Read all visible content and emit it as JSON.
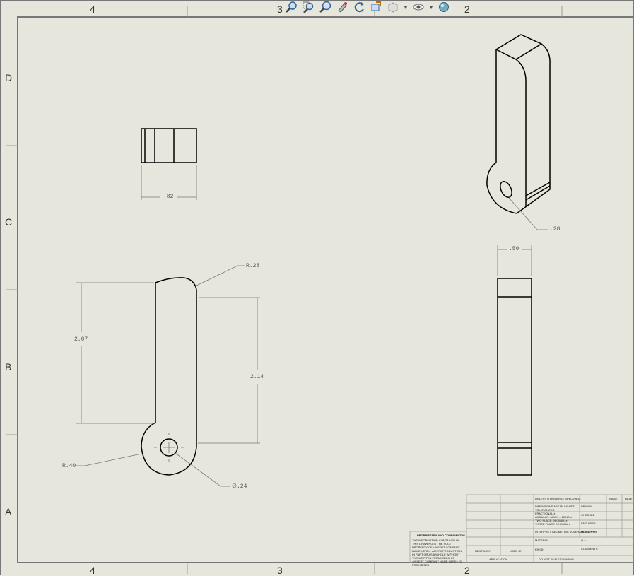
{
  "zones": {
    "top": [
      "4",
      "3",
      "2"
    ],
    "bottom": [
      "4",
      "3",
      "2"
    ],
    "left": [
      "D",
      "C",
      "B",
      "A"
    ]
  },
  "toolbar": {
    "icons": [
      "zoom-to-fit-icon",
      "zoom-to-area-icon",
      "zoom-in-out-icon",
      "pan-icon",
      "rotate-icon",
      "previous-view-icon",
      "display-style-icon",
      "hide-show-icon",
      "appearance-icon"
    ]
  },
  "dimensions": {
    "top_view_width": ".82",
    "iso_hole": ".28",
    "side_width": ".50",
    "front_radius_top": "R.28",
    "front_height_left": "2.07",
    "front_height_right": "2.14",
    "front_radius_bottom": "R.40",
    "front_hole_dia": "∅.24"
  },
  "title_block": {
    "unless_specified": "UNLESS OTHERWISE SPECIFIED:",
    "dims_in": "DIMENSIONS ARE IN INCHES",
    "tolerances": "TOLERANCES:",
    "fractional": "FRACTIONAL ±",
    "angular": "ANGULAR: MACH ±   BEND ±",
    "two_place": "TWO PLACE DECIMAL ±",
    "three_place": "THREE PLACE DECIMAL ±",
    "interpret": "INTERPRET GEOMETRIC TOLERANCING PER:",
    "material": "MATERIAL",
    "finish": "FINISH",
    "drawn": "DRAWN",
    "checked": "CHECKED",
    "eng_appr": "ENG APPR.",
    "mfg_appr": "MFG APPR.",
    "qa": "Q.A.",
    "comments": "COMMENTS:",
    "name": "NAME",
    "date": "DATE",
    "next_assy": "NEXT ASSY",
    "used_on": "USED ON",
    "application": "APPLICATION",
    "do_not_scale": "DO NOT SCALE DRAWING",
    "proprietary_title": "PROPRIETARY AND CONFIDENTIAL",
    "proprietary_text": "THE INFORMATION CONTAINED IN THIS DRAWING IS THE SOLE PROPERTY OF <INSERT COMPANY NAME HERE>. ANY REPRODUCTION IN PART OR AS A WHOLE WITHOUT THE WRITTEN PERMISSION OF <INSERT COMPANY NAME HERE> IS PROHIBITED."
  }
}
